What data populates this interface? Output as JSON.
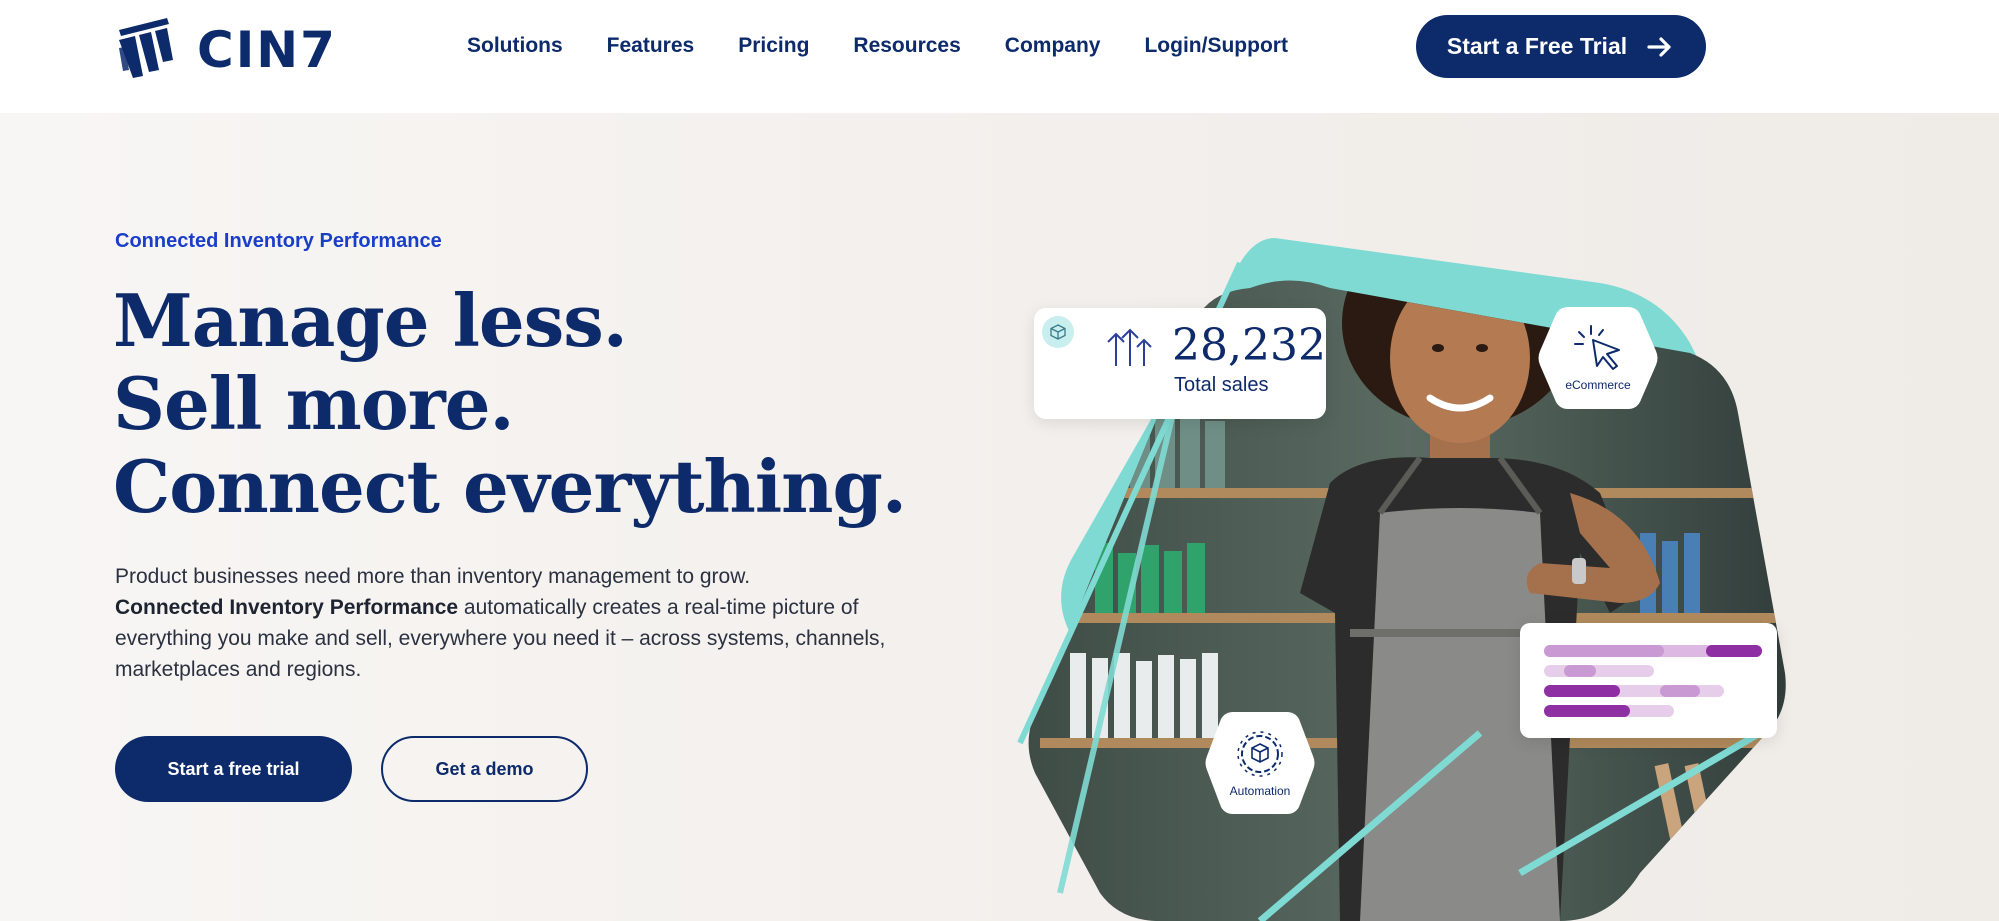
{
  "brand": {
    "name": "CIN7"
  },
  "nav": {
    "items": [
      "Solutions",
      "Features",
      "Pricing",
      "Resources",
      "Company",
      "Login/Support"
    ]
  },
  "header_cta": {
    "label": "Start a Free Trial"
  },
  "hero": {
    "eyebrow": "Connected Inventory Performance",
    "headline": [
      "Manage less.",
      "Sell more.",
      "Connect everything."
    ],
    "body_line1": "Product businesses need more than inventory management to grow.",
    "body_bold": "Connected Inventory Performance",
    "body_rest": " automatically creates a real-time picture of everything you make and sell, everywhere you need it – across systems, channels, marketplaces and regions.",
    "primary_button": "Start a free trial",
    "secondary_button": "Get a demo"
  },
  "visual": {
    "sales_value": "28,232",
    "sales_label": "Total sales",
    "ecommerce_label": "eCommerce",
    "automation_label": "Automation"
  },
  "colors": {
    "navy": "#0d2a6b",
    "accent_blue": "#1a3ec8",
    "teal": "#7fdad3",
    "purple": "#8e2fa3",
    "hero_bg": "#f3f0ed"
  },
  "icons": [
    "logo-mark-icon",
    "arrow-right-icon",
    "box-icon",
    "up-arrows-icon",
    "cursor-click-icon",
    "gear-box-icon"
  ]
}
